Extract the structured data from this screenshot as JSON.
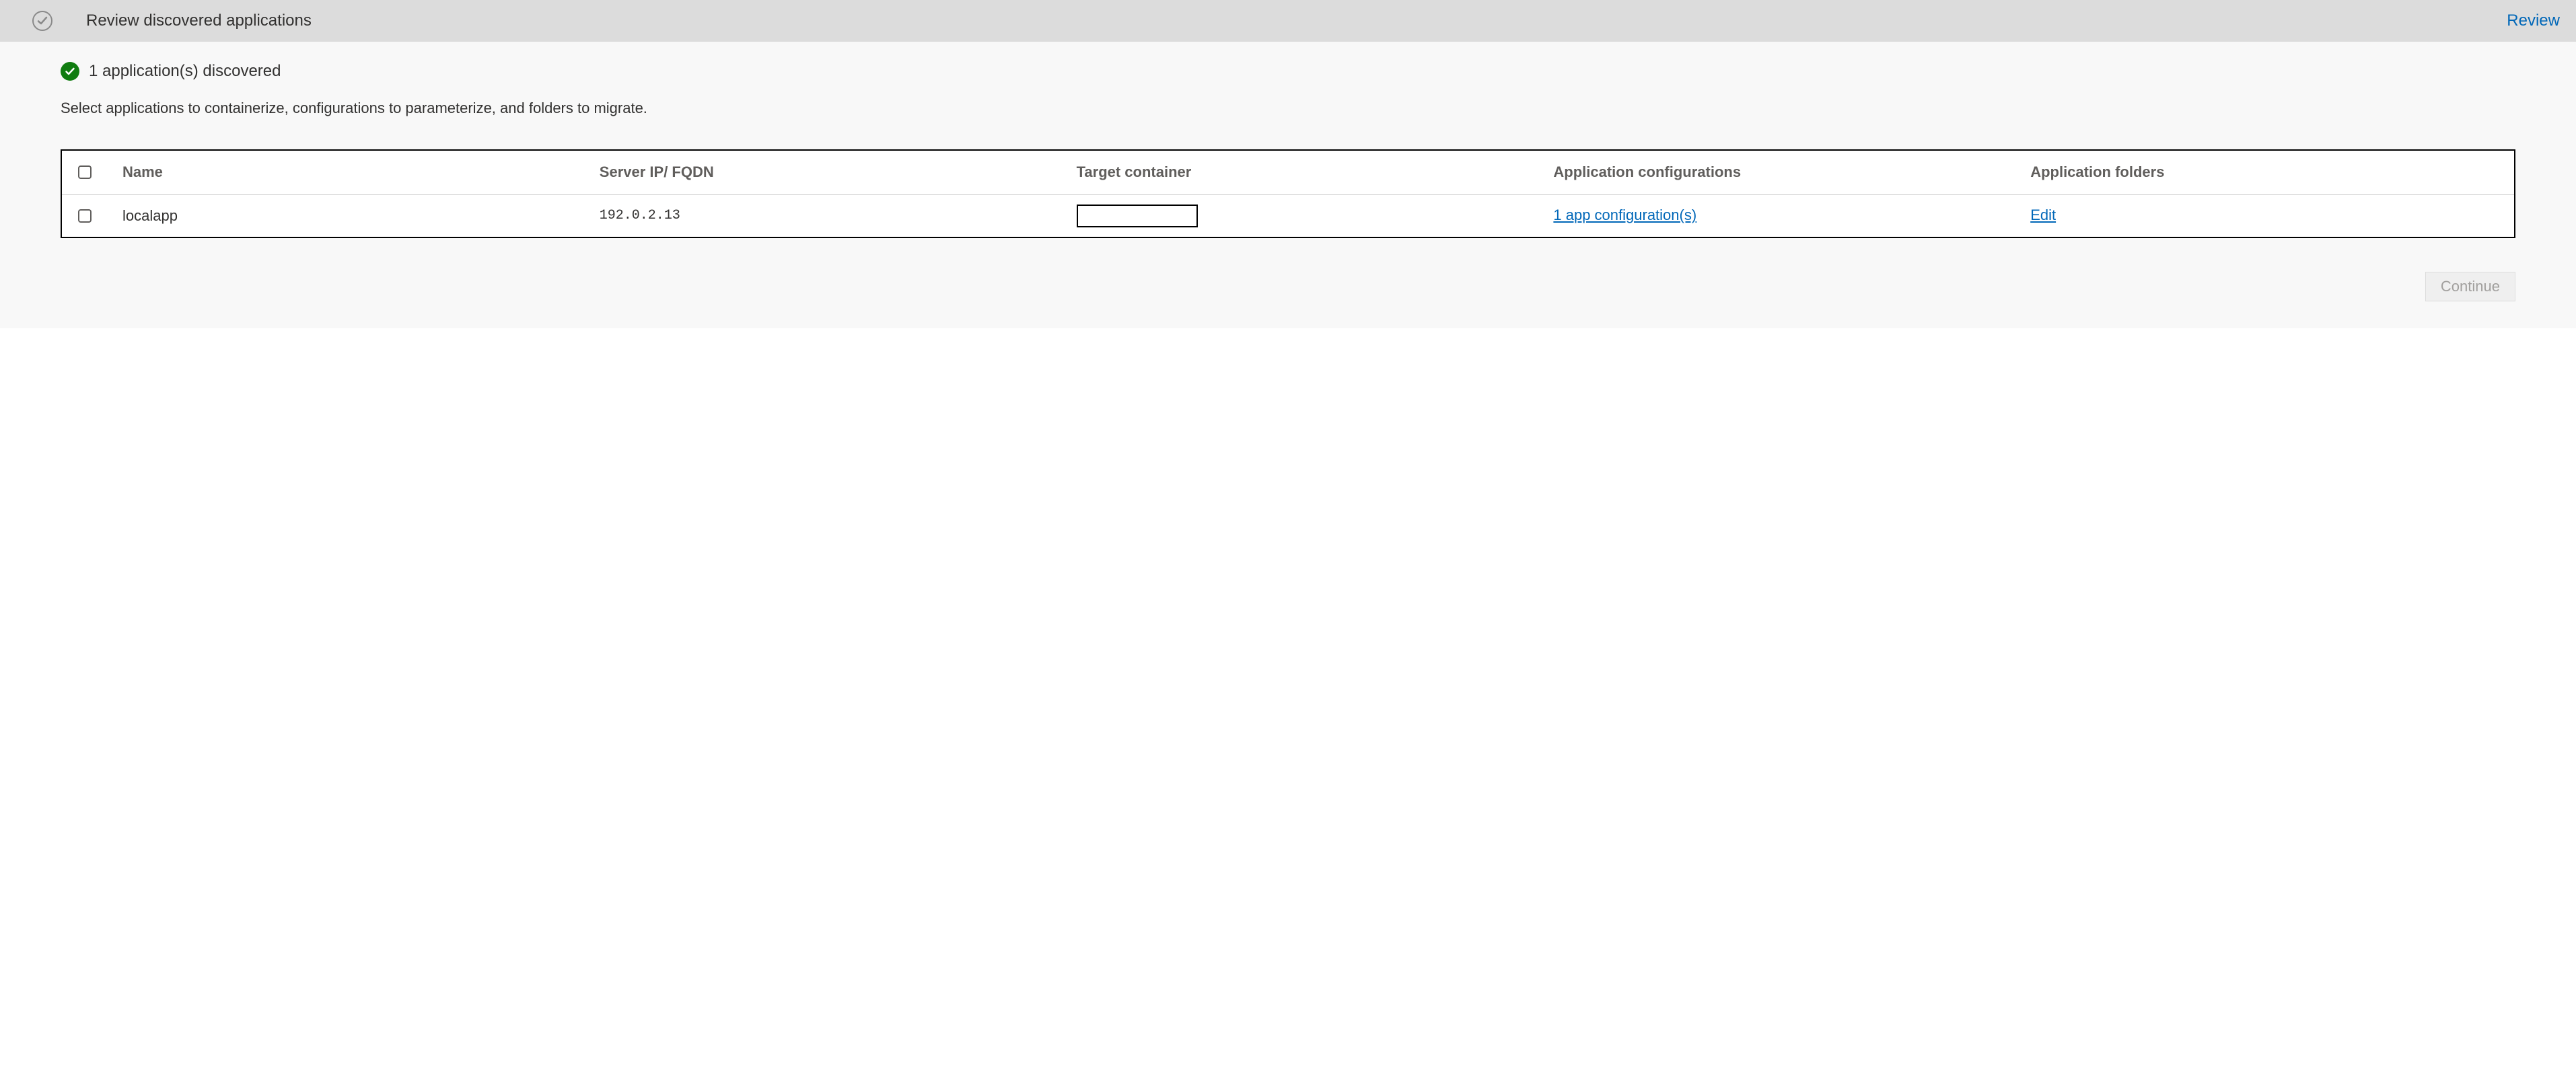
{
  "header": {
    "title": "Review discovered applications",
    "review_link": "Review"
  },
  "status": {
    "message": "1 application(s) discovered"
  },
  "instruction": "Select applications to containerize, configurations to parameterize, and folders to migrate.",
  "table": {
    "headers": {
      "name": "Name",
      "server": "Server IP/ FQDN",
      "target": "Target container",
      "configs": "Application configurations",
      "folders": "Application folders"
    },
    "rows": [
      {
        "name": "localapp",
        "server": "192.0.2.13",
        "target": "",
        "configs_link": "1 app configuration(s)",
        "folders_link": "Edit"
      }
    ]
  },
  "footer": {
    "continue_label": "Continue"
  }
}
